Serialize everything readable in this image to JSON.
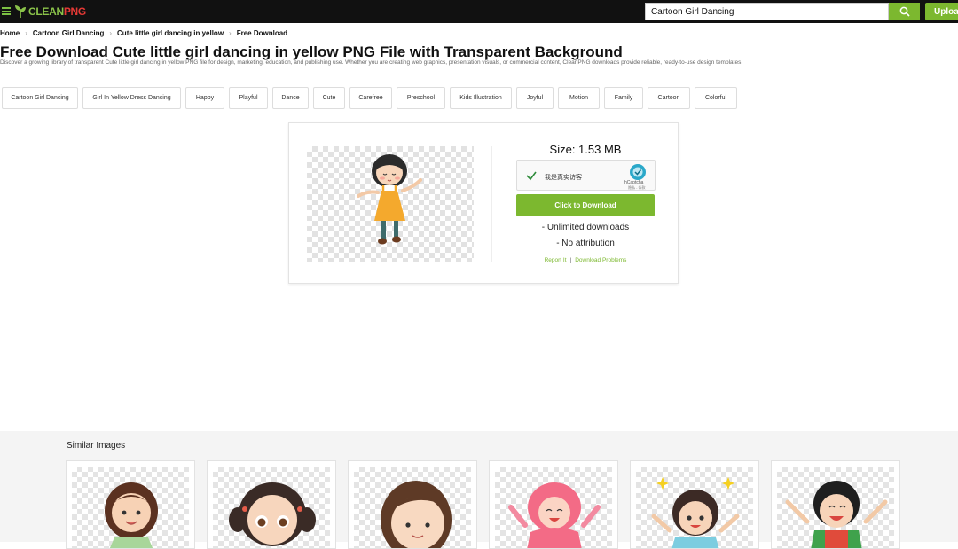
{
  "header": {
    "logo_clean": "CLEAN",
    "logo_png": "PNG",
    "search_value": "Cartoon Girl Dancing",
    "upload_label": "Upload"
  },
  "breadcrumb": [
    "Home",
    "Cartoon Girl Dancing",
    "Cute little girl dancing in yellow",
    "Free Download"
  ],
  "page": {
    "title": "Free Download Cute little girl dancing in yellow PNG File with Transparent Background",
    "description": "Discover a growing library of transparent Cute little girl dancing in yellow PNG file for design, marketing, education, and publishing use. Whether you are creating web graphics, presentation visuals, or commercial content, CleanPNG downloads provide reliable, ready-to-use design templates."
  },
  "tags": [
    "Cartoon Girl Dancing",
    "Girl In Yellow Dress Dancing",
    "Happy",
    "Playful",
    "Dance",
    "Cute",
    "Carefree",
    "Preschool",
    "Kids Illustration",
    "Joyful",
    "Motion",
    "Family",
    "Cartoon",
    "Colorful"
  ],
  "download_card": {
    "size_text": "Size: 1.53 MB",
    "captcha_label": "我是真实访客",
    "captcha_brand": "hCaptcha",
    "captcha_links": "隐私 - 条款",
    "download_button": "Click to Download",
    "feature_1": "- Unlimited downloads",
    "feature_2": "- No attribution",
    "report_link": "Report It",
    "link_separator": "|",
    "problems_link": "Download Problems"
  },
  "similar": {
    "title": "Similar Images"
  },
  "colors": {
    "accent_green": "#7cb82f",
    "topbar": "#111111",
    "logo_red": "#e53935"
  }
}
